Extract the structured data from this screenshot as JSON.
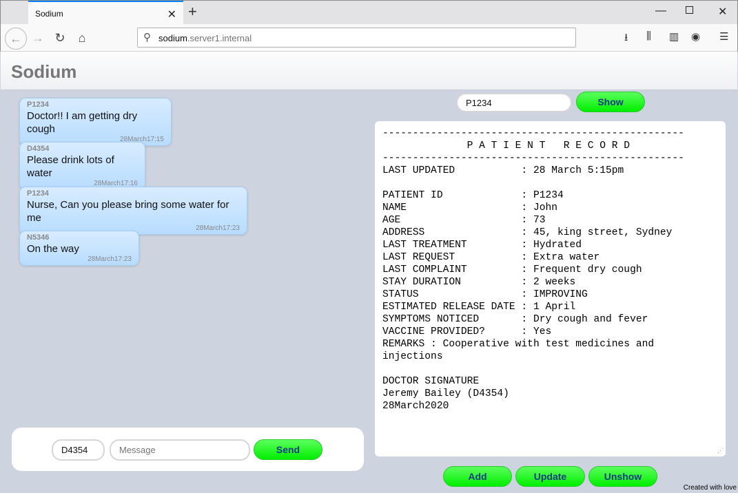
{
  "browser": {
    "tab_title": "Sodium",
    "url_host": "sodium",
    "url_rest": ".server1.internal"
  },
  "app": {
    "title": "Sodium"
  },
  "messages": [
    {
      "sender": "P1234",
      "text": "Doctor!! I am getting dry cough",
      "time": "28March17:15"
    },
    {
      "sender": "D4354",
      "text": "Please drink lots of water",
      "time": "28March17:16"
    },
    {
      "sender": "P1234",
      "text": "Nurse, Can you please bring some water for me",
      "time": "28March17:23"
    },
    {
      "sender": "N5346",
      "text": "On the way",
      "time": "28March17:23"
    }
  ],
  "compose": {
    "sender_value": "D4354",
    "message_placeholder": "Message",
    "send_label": "Send"
  },
  "record_panel": {
    "patient_id_value": "P1234",
    "show_label": "Show",
    "record_text": "--------------------------------------------------\n              P A T I E N T   R E C O R D\n--------------------------------------------------\nLAST UPDATED           : 28 March 5:15pm\n\nPATIENT ID             : P1234\nNAME                   : John\nAGE                    : 73\nADDRESS                : 45, king street, Sydney\nLAST TREATMENT         : Hydrated\nLAST REQUEST           : Extra water\nLAST COMPLAINT         : Frequent dry cough\nSTAY DURATION          : 2 weeks\nSTATUS                 : IMPROVING\nESTIMATED RELEASE DATE : 1 April\nSYMPTOMS NOTICED       : Dry cough and fever\nVACCINE PROVIDED?      : Yes\nREMARKS : Cooperative with test medicines and\ninjections\n\nDOCTOR SIGNATURE\nJeremy Bailey (D4354)\n28March2020",
    "add_label": "Add",
    "update_label": "Update",
    "unshow_label": "Unshow"
  },
  "footer": {
    "note": "Created with love"
  },
  "colors": {
    "button_green": "#00ee00",
    "bubble_blue": "#b8dcff",
    "background": "#cdd4e0"
  }
}
